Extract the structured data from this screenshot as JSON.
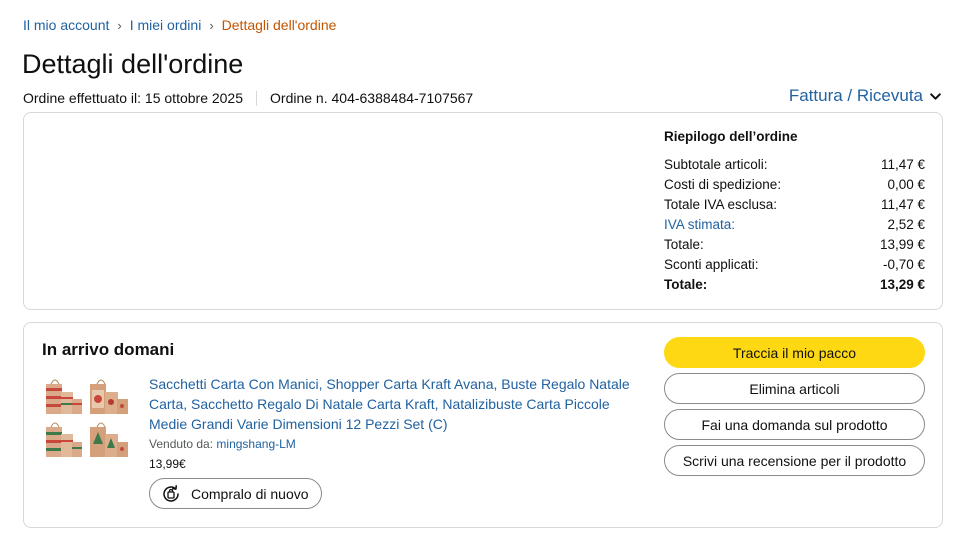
{
  "breadcrumb": {
    "items": [
      "Il mio account",
      "I miei ordini",
      "Dettagli dell'ordine"
    ],
    "separator": "›"
  },
  "page_title": "Dettagli dell'ordine",
  "order_meta": {
    "date": "Ordine effettuato il: 15 ottobre 2025",
    "number": "Ordine n. 404-6388484-7107567"
  },
  "invoice_link": "Fattura / Ricevuta",
  "summary": {
    "title": "Riepilogo dell’ordine",
    "rows": [
      {
        "label": "Subtotale articoli:",
        "value": "11,47 €"
      },
      {
        "label": "Costi di spedizione:",
        "value": "0,00 €"
      },
      {
        "label": "Totale IVA esclusa:",
        "value": "11,47 €"
      },
      {
        "label": "IVA stimata:",
        "value": "2,52 €"
      },
      {
        "label": "Totale:",
        "value": "13,99 €"
      },
      {
        "label": "Sconti applicati:",
        "value": "-0,70 €"
      },
      {
        "label": "Totale:",
        "value": "13,29 €"
      }
    ]
  },
  "shipment": {
    "status": "In arrivo domani",
    "product_title": "Sacchetti Carta Con Manici, Shopper Carta Kraft Avana, Buste Regalo Natale Carta, Sacchetto Regalo Di Natale Carta Kraft, Natalizibuste Carta Piccole Medie Grandi Varie Dimensioni 12 Pezzi Set (C)",
    "sold_by_label": "Venduto da:",
    "seller": "mingshang-LM",
    "price": "13,99€",
    "buy_again": "Compralo di nuovo"
  },
  "actions": {
    "track": "Traccia il mio pacco",
    "remove": "Elimina articoli",
    "ask": "Fai una domanda sul prodotto",
    "review": "Scrivi una recensione per il prodotto"
  },
  "colors": {
    "link": "#2162a1",
    "current_crumb": "#c45500",
    "primary_button": "#ffd814",
    "border": "#d5d9d9"
  },
  "icons": [
    "chevron-down-icon",
    "buy-again-icon",
    "product-image"
  ]
}
